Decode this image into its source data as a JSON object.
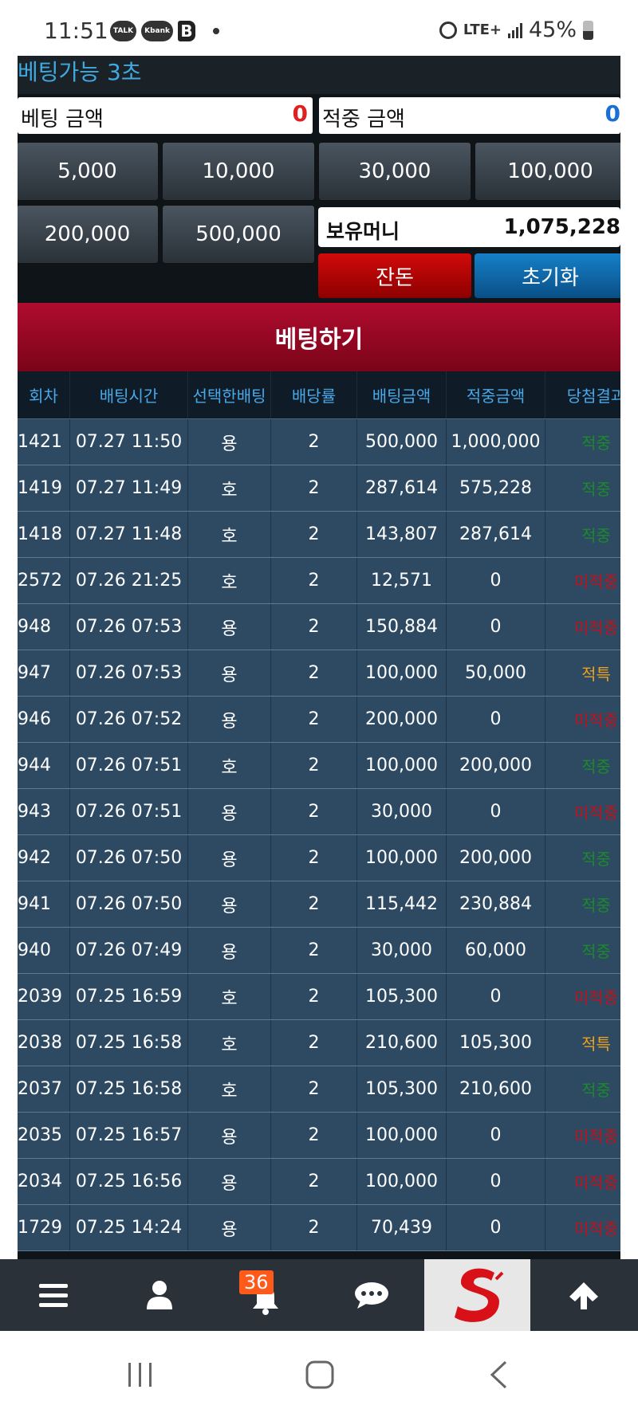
{
  "status_bar": {
    "time": "11:51",
    "badge_talk": "TALK",
    "badge_kbank": "Kbank",
    "badge_b": "B",
    "network": "LTE+",
    "battery": "45%"
  },
  "timer_text": "베팅가능 3초",
  "bet_amount": {
    "label": "베팅 금액",
    "value": "0",
    "color": "#e02020"
  },
  "win_amount": {
    "label": "적중 금액",
    "value": "0",
    "color": "#1a6fd6"
  },
  "chips": [
    "5,000",
    "10,000",
    "30,000",
    "100,000",
    "200,000",
    "500,000"
  ],
  "money": {
    "label": "보유머니",
    "value": "1,075,228"
  },
  "buttons": {
    "change": "잔돈",
    "reset": "초기화",
    "bet": "베팅하기"
  },
  "table": {
    "headers": [
      "회차",
      "배팅시간",
      "선택한배팅",
      "배당률",
      "배팅금액",
      "적중금액",
      "당첨결과"
    ],
    "rows": [
      {
        "round": "1421",
        "time": "07.27 11:50",
        "pick": "용",
        "odds": "2",
        "bet": "500,000",
        "win": "1,000,000",
        "result": "적중",
        "result_color": "#1a8a2a"
      },
      {
        "round": "1419",
        "time": "07.27 11:49",
        "pick": "호",
        "odds": "2",
        "bet": "287,614",
        "win": "575,228",
        "result": "적중",
        "result_color": "#1a8a2a"
      },
      {
        "round": "1418",
        "time": "07.27 11:48",
        "pick": "호",
        "odds": "2",
        "bet": "143,807",
        "win": "287,614",
        "result": "적중",
        "result_color": "#1a8a2a"
      },
      {
        "round": "2572",
        "time": "07.26 21:25",
        "pick": "호",
        "odds": "2",
        "bet": "12,571",
        "win": "0",
        "result": "미적중",
        "result_color": "#c0121b"
      },
      {
        "round": "948",
        "time": "07.26 07:53",
        "pick": "용",
        "odds": "2",
        "bet": "150,884",
        "win": "0",
        "result": "미적중",
        "result_color": "#c0121b"
      },
      {
        "round": "947",
        "time": "07.26 07:53",
        "pick": "용",
        "odds": "2",
        "bet": "100,000",
        "win": "50,000",
        "result": "적특",
        "result_color": "#e8a020"
      },
      {
        "round": "946",
        "time": "07.26 07:52",
        "pick": "용",
        "odds": "2",
        "bet": "200,000",
        "win": "0",
        "result": "미적중",
        "result_color": "#c0121b"
      },
      {
        "round": "944",
        "time": "07.26 07:51",
        "pick": "호",
        "odds": "2",
        "bet": "100,000",
        "win": "200,000",
        "result": "적중",
        "result_color": "#1a8a2a"
      },
      {
        "round": "943",
        "time": "07.26 07:51",
        "pick": "용",
        "odds": "2",
        "bet": "30,000",
        "win": "0",
        "result": "미적중",
        "result_color": "#c0121b"
      },
      {
        "round": "942",
        "time": "07.26 07:50",
        "pick": "용",
        "odds": "2",
        "bet": "100,000",
        "win": "200,000",
        "result": "적중",
        "result_color": "#1a8a2a"
      },
      {
        "round": "941",
        "time": "07.26 07:50",
        "pick": "용",
        "odds": "2",
        "bet": "115,442",
        "win": "230,884",
        "result": "적중",
        "result_color": "#1a8a2a"
      },
      {
        "round": "940",
        "time": "07.26 07:49",
        "pick": "용",
        "odds": "2",
        "bet": "30,000",
        "win": "60,000",
        "result": "적중",
        "result_color": "#1a8a2a"
      },
      {
        "round": "2039",
        "time": "07.25 16:59",
        "pick": "호",
        "odds": "2",
        "bet": "105,300",
        "win": "0",
        "result": "미적중",
        "result_color": "#c0121b"
      },
      {
        "round": "2038",
        "time": "07.25 16:58",
        "pick": "호",
        "odds": "2",
        "bet": "210,600",
        "win": "105,300",
        "result": "적특",
        "result_color": "#e8a020"
      },
      {
        "round": "2037",
        "time": "07.25 16:58",
        "pick": "호",
        "odds": "2",
        "bet": "105,300",
        "win": "210,600",
        "result": "적중",
        "result_color": "#1a8a2a"
      },
      {
        "round": "2035",
        "time": "07.25 16:57",
        "pick": "용",
        "odds": "2",
        "bet": "100,000",
        "win": "0",
        "result": "미적중",
        "result_color": "#c0121b"
      },
      {
        "round": "2034",
        "time": "07.25 16:56",
        "pick": "용",
        "odds": "2",
        "bet": "100,000",
        "win": "0",
        "result": "미적중",
        "result_color": "#c0121b"
      },
      {
        "round": "1729",
        "time": "07.25 14:24",
        "pick": "용",
        "odds": "2",
        "bet": "70,439",
        "win": "0",
        "result": "미적중",
        "result_color": "#c0121b"
      }
    ]
  },
  "bottom_nav": {
    "items": [
      "menu-icon",
      "user-icon",
      "bell-icon",
      "chat-icon",
      "site-logo",
      "arrow-up-icon"
    ],
    "notification_count": "36"
  }
}
